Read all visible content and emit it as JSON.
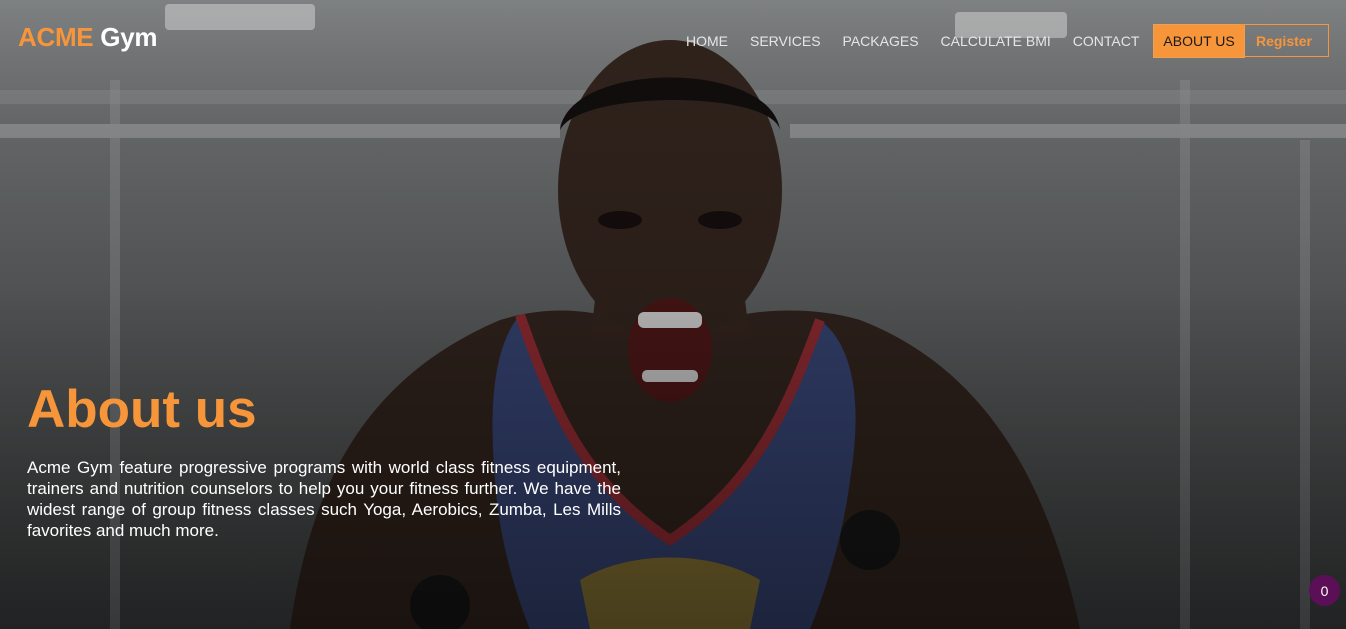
{
  "brand": {
    "part1": "ACME",
    "part2": "Gym"
  },
  "nav": {
    "items": [
      {
        "label": "HOME"
      },
      {
        "label": "SERVICES"
      },
      {
        "label": "PACKAGES"
      },
      {
        "label": "CALCULATE BMI"
      },
      {
        "label": "CONTACT"
      },
      {
        "label": "ABOUT US",
        "active": true
      }
    ],
    "register_label": "Register"
  },
  "hero": {
    "title": "About us",
    "description": "Acme Gym feature progressive programs with world class fitness equipment, trainers and nutrition counselors to help you your fitness further. We have the widest range of group fitness classes such Yoga, Aerobics, Zumba, Les Mills favorites and much more."
  },
  "badge": {
    "count": "0"
  },
  "colors": {
    "accent": "#f7953a",
    "badge_bg": "#5b0f57"
  }
}
